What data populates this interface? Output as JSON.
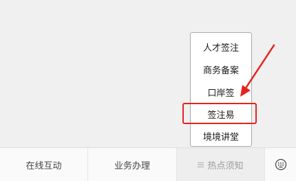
{
  "menu": {
    "items": [
      {
        "label": "人才签注"
      },
      {
        "label": "商务备案"
      },
      {
        "label": "口岸签"
      },
      {
        "label": "签注易"
      },
      {
        "label": "境境讲堂"
      }
    ]
  },
  "bottom_bar": {
    "tabs": [
      {
        "label": "在线互动"
      },
      {
        "label": "业务办理"
      },
      {
        "label": "热点须知",
        "icon": "hamburger-menu-icon"
      },
      {
        "icon": "keyboard-icon"
      }
    ]
  },
  "annotation": {
    "highlight_color": "#e8211b",
    "highlighted_item": "签注易"
  }
}
